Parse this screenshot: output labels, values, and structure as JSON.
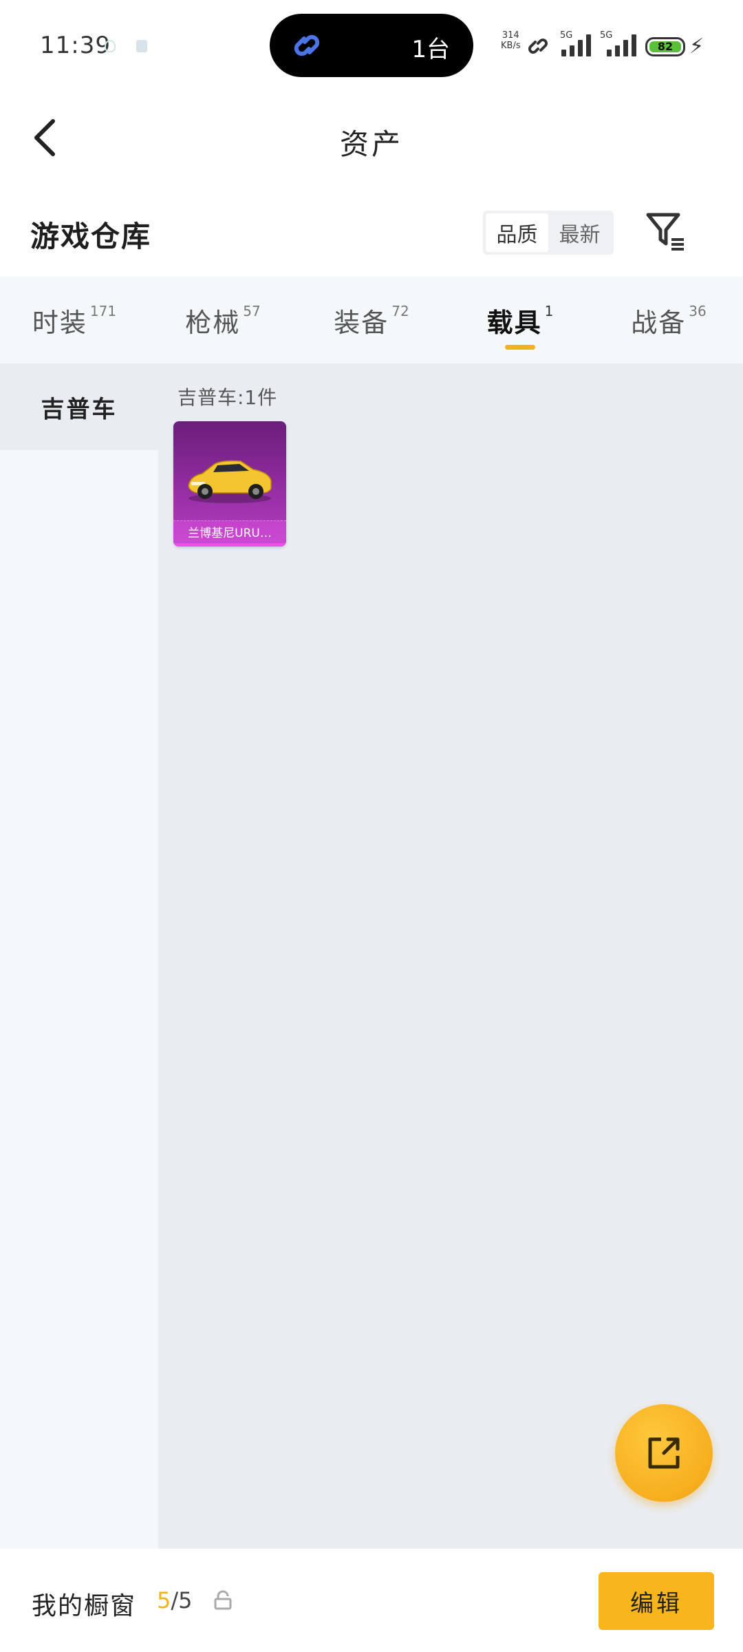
{
  "status_bar": {
    "time": "11:39",
    "pill_text": "1台",
    "net_speed": "314",
    "net_unit": "KB/s",
    "sim1_label": "5G",
    "sim2_label": "5G",
    "battery": "82"
  },
  "header": {
    "title": "资产"
  },
  "warehouse": {
    "title": "游戏仓库",
    "sort_options": [
      "品质",
      "最新"
    ],
    "sort_selected": "品质"
  },
  "tabs": [
    {
      "label": "时装",
      "count": "171",
      "active": false
    },
    {
      "label": "枪械",
      "count": "57",
      "active": false
    },
    {
      "label": "装备",
      "count": "72",
      "active": false
    },
    {
      "label": "载具",
      "count": "1",
      "active": true
    },
    {
      "label": "战备",
      "count": "36",
      "active": false
    }
  ],
  "sidebar": {
    "items": [
      {
        "label": "吉普车",
        "active": true
      }
    ]
  },
  "content": {
    "group_label": "吉普车:1件",
    "items": [
      {
        "name": "兰博基尼URU…",
        "rarity_color": "#b640c3"
      }
    ]
  },
  "bottom_bar": {
    "window_label": "我的橱窗",
    "window_current": "5",
    "window_total": "/5",
    "edit_label": "编辑"
  },
  "colors": {
    "accent": "#f9b51c",
    "tab_underline": "#f2b21a",
    "rarity_purple": "#8d2a9c"
  }
}
